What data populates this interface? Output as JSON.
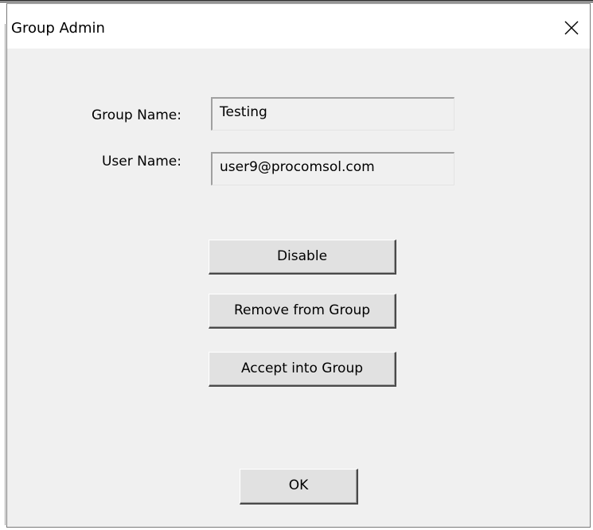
{
  "dialog": {
    "title": "Group Admin",
    "close_glyph": "✕"
  },
  "fields": {
    "group_name_label": "Group Name:",
    "group_name_value": "Testing",
    "user_name_label": "User Name:",
    "user_name_value": "user9@procomsol.com"
  },
  "buttons": {
    "disable": "Disable",
    "remove": "Remove from Group",
    "accept": "Accept into Group",
    "ok": "OK"
  },
  "icons": {
    "close": "close-icon"
  },
  "colors": {
    "dialog_background": "#f0f0f0",
    "titlebar_background": "#ffffff",
    "button_face": "#e1e1e1"
  }
}
